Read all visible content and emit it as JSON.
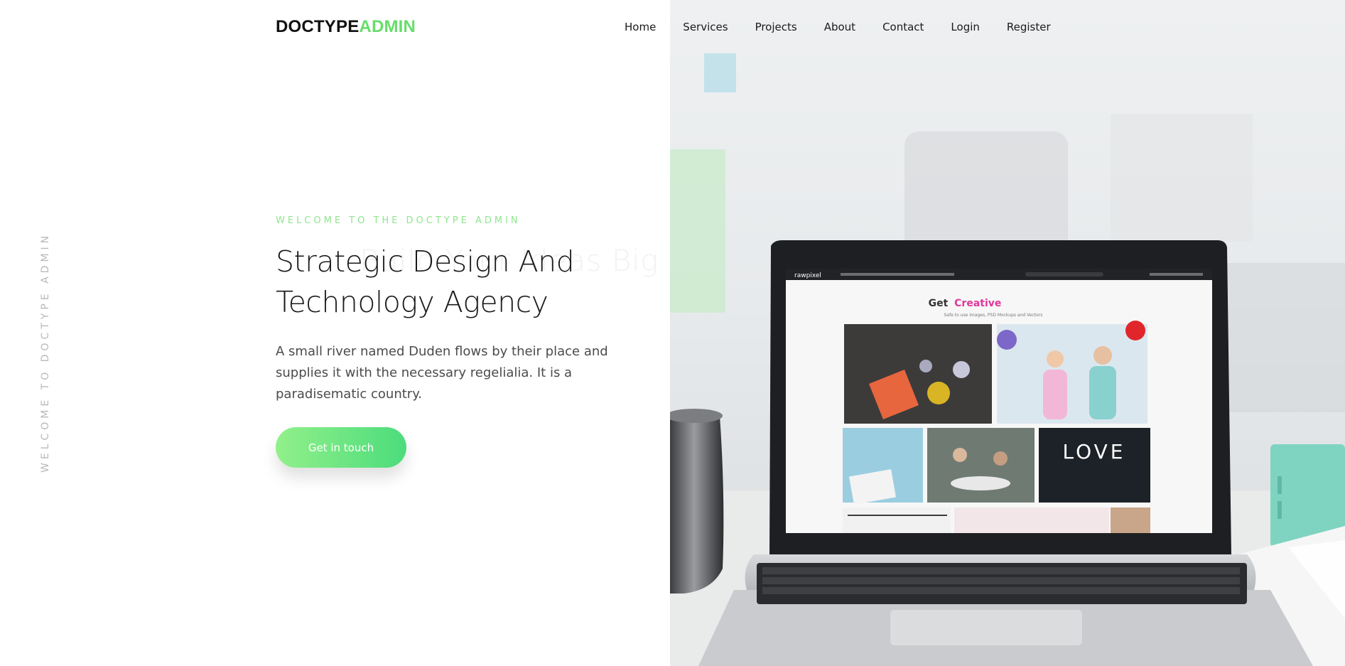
{
  "brand": {
    "part1": "DOCTYPE",
    "part2": "ADMIN",
    "accent_color": "#67dd6b"
  },
  "nav": {
    "items": [
      {
        "label": "Home"
      },
      {
        "label": "Services"
      },
      {
        "label": "Projects"
      },
      {
        "label": "About"
      },
      {
        "label": "Contact"
      },
      {
        "label": "Login"
      },
      {
        "label": "Register"
      }
    ]
  },
  "side_label": "WELCOME TO DOCTYPE ADMIN",
  "hero": {
    "kicker": "WELCOME TO THE DOCTYPE ADMIN",
    "ghost_heading": "Build Your Ideas Big",
    "headline_line1": "Strategic Design And",
    "headline_line2": "Technology Agency",
    "lede_line1": "A small river named Duden flows by their place and",
    "lede_line2": "supplies it with the necessary regelialia. It is a",
    "lede_line3": "paradisematic country.",
    "cta_label": "Get in touch"
  },
  "screen": {
    "site_logo": "rawpixel",
    "heading_plain": "Get",
    "heading_accent": "Creative",
    "subheading": "Safe to use images, PSD Mockups and Vectors",
    "love_word": "LOVE"
  },
  "colors": {
    "accent": "#67dd6b",
    "cta_start": "#92f08a",
    "cta_end": "#4cdc7c",
    "screen_accent": "#e0389a"
  }
}
